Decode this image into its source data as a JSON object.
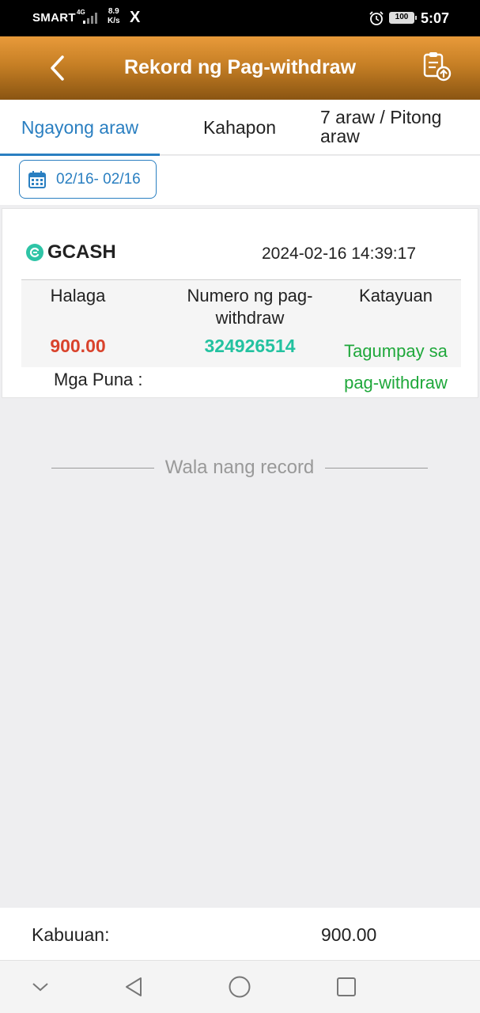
{
  "status_bar": {
    "carrier": "SMART",
    "network": "4G",
    "speed_value": "8.9",
    "speed_unit": "K/s",
    "app_icon": "X",
    "battery": "100",
    "time": "5:07"
  },
  "header": {
    "title": "Rekord ng Pag-withdraw",
    "back_icon": "chevron-left-icon",
    "action_icon": "clipboard-upload-icon"
  },
  "tabs": [
    {
      "label": "Ngayong araw",
      "active": true
    },
    {
      "label": "Kahapon",
      "active": false
    },
    {
      "label": "7 araw / Pitong araw",
      "active": false
    }
  ],
  "filter": {
    "date_range": "02/16- 02/16"
  },
  "record": {
    "method": "GCASH",
    "timestamp": "2024-02-16 14:39:17",
    "col_amount_label": "Halaga",
    "col_number_label": "Numero ng pag-withdraw",
    "col_status_label": "Katayuan",
    "amount": "900.00",
    "withdraw_number": "324926514",
    "status": "Tagumpay sa pag-withdraw",
    "remarks_label": "Mga Puna :"
  },
  "empty_message": "Wala nang record",
  "total": {
    "label": "Kabuuan:",
    "value": "900.00"
  },
  "colors": {
    "accent": "#2a7fc1",
    "header_top": "#e89a3a",
    "header_bottom": "#8a5512",
    "amount": "#d9432c",
    "number": "#23c2a0",
    "success": "#1fa83b"
  }
}
